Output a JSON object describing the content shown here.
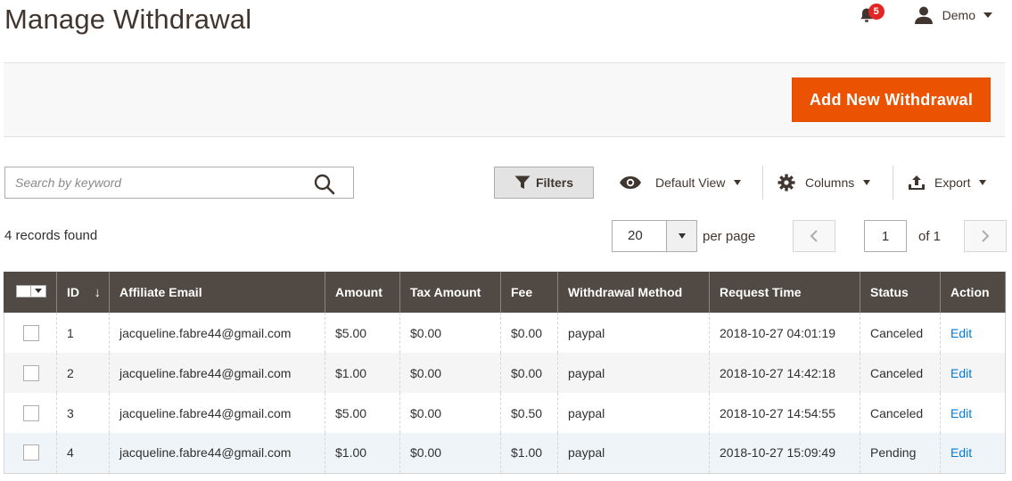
{
  "page": {
    "title": "Manage Withdrawal"
  },
  "header": {
    "notifications_count": "5",
    "user_name": "Demo"
  },
  "actions": {
    "add_button_label": "Add New Withdrawal"
  },
  "search": {
    "placeholder": "Search by keyword",
    "value": ""
  },
  "toolbar": {
    "filters_label": "Filters",
    "view_label": "Default View",
    "columns_label": "Columns",
    "export_label": "Export"
  },
  "summary": {
    "records_found": "4 records found"
  },
  "pagination": {
    "per_page_value": "20",
    "per_page_label": "per page",
    "current_page": "1",
    "of_label": "of 1"
  },
  "grid": {
    "columns": [
      "ID",
      "Affiliate Email",
      "Amount",
      "Tax Amount",
      "Fee",
      "Withdrawal Method",
      "Request Time",
      "Status",
      "Action"
    ],
    "sort_indicator": "↓",
    "rows": [
      {
        "id": "1",
        "email": "jacqueline.fabre44@gmail.com",
        "amount": "$5.00",
        "tax": "$0.00",
        "fee": "$0.00",
        "method": "paypal",
        "time": "2018-10-27 04:01:19",
        "status": "Canceled",
        "action": "Edit"
      },
      {
        "id": "2",
        "email": "jacqueline.fabre44@gmail.com",
        "amount": "$1.00",
        "tax": "$0.00",
        "fee": "$0.00",
        "method": "paypal",
        "time": "2018-10-27 14:42:18",
        "status": "Canceled",
        "action": "Edit"
      },
      {
        "id": "3",
        "email": "jacqueline.fabre44@gmail.com",
        "amount": "$5.00",
        "tax": "$0.00",
        "fee": "$0.50",
        "method": "paypal",
        "time": "2018-10-27 14:54:55",
        "status": "Canceled",
        "action": "Edit"
      },
      {
        "id": "4",
        "email": "jacqueline.fabre44@gmail.com",
        "amount": "$1.00",
        "tax": "$0.00",
        "fee": "$1.00",
        "method": "paypal",
        "time": "2018-10-27 15:09:49",
        "status": "Pending",
        "action": "Edit"
      }
    ]
  },
  "colors": {
    "primary_button": "#eb5202",
    "grid_header": "#514943",
    "link": "#007bdb",
    "badge": "#e22626"
  }
}
